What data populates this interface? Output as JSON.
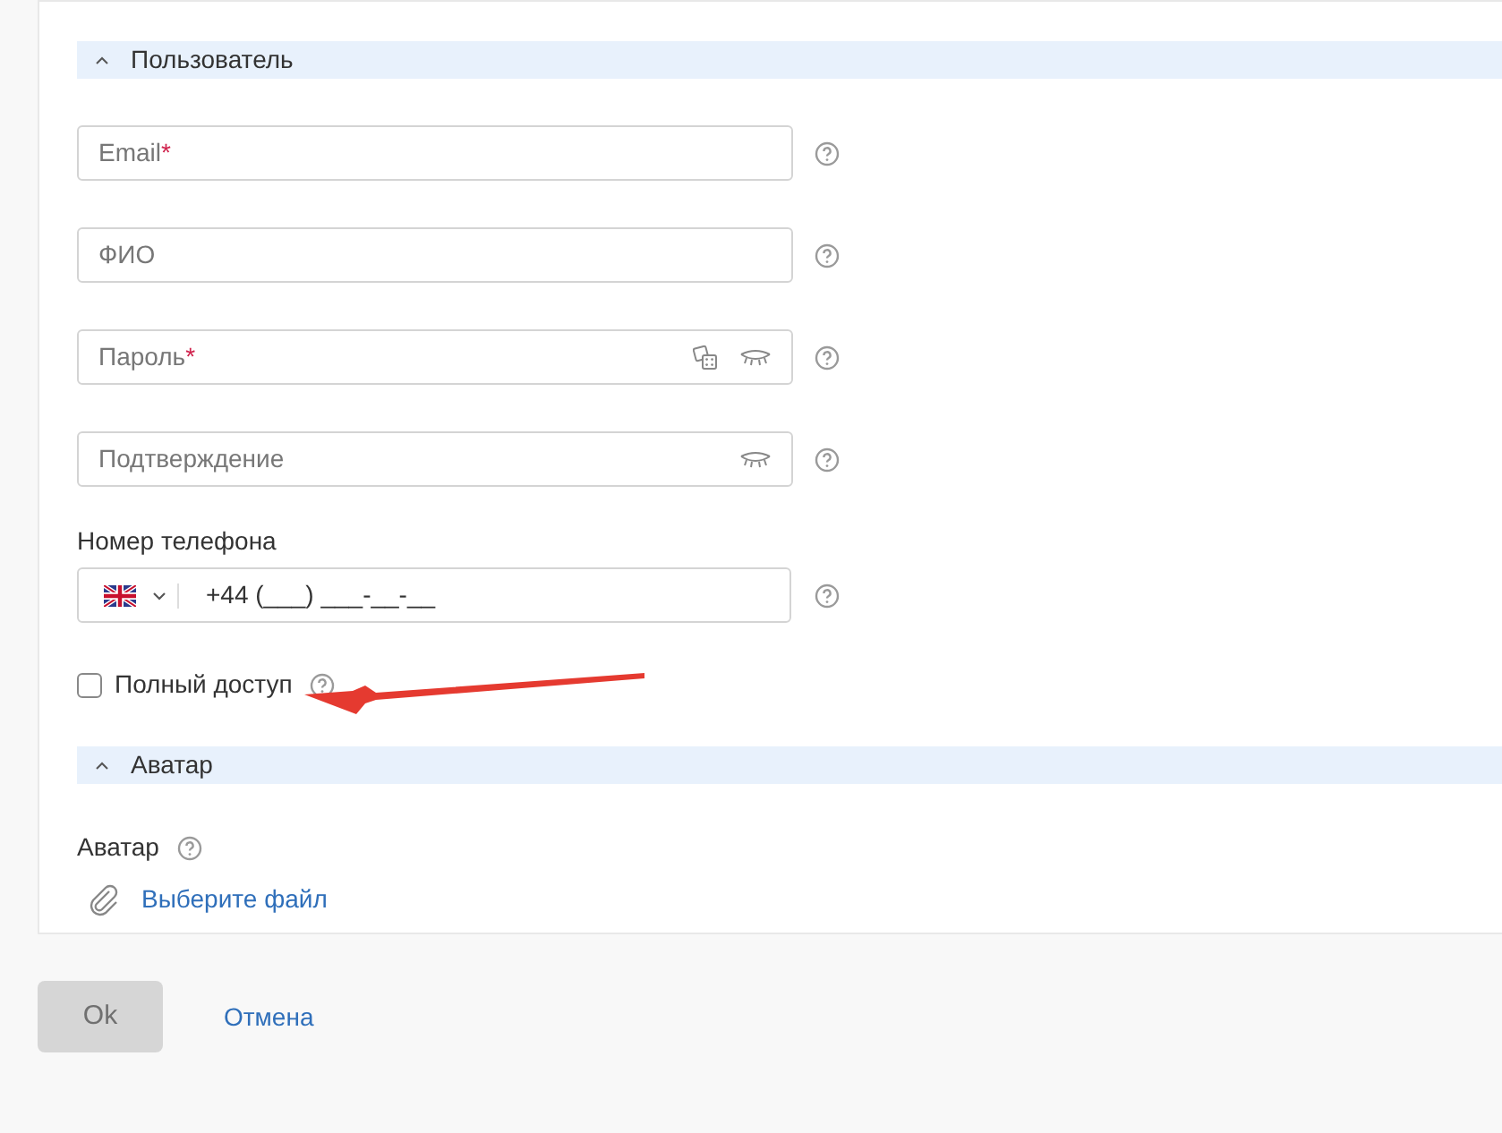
{
  "sections": [
    {
      "title": "Пользователь",
      "expanded": true
    },
    {
      "title": "Аватар",
      "expanded": true
    }
  ],
  "fields": [
    {
      "kind": "text",
      "placeholder": "Email",
      "required_mark": "*"
    },
    {
      "kind": "text",
      "placeholder": "ФИО"
    },
    {
      "kind": "password",
      "placeholder": "Пароль",
      "required_mark": "*",
      "generate": true
    },
    {
      "kind": "password",
      "placeholder": "Подтверждение",
      "generate": false
    }
  ],
  "phone": {
    "label": "Номер телефона",
    "value": "+44 (___) ___-__-__"
  },
  "full_access": {
    "label": "Полный доступ",
    "checked": false
  },
  "avatar": {
    "label": "Аватар",
    "link": "Выберите файл"
  },
  "buttons": {
    "ok": "Ok",
    "cancel": "Отмена"
  }
}
